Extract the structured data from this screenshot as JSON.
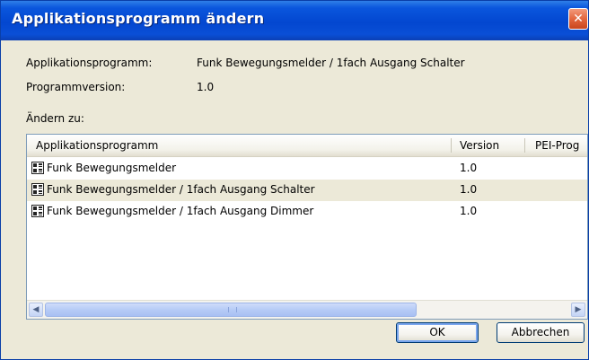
{
  "window": {
    "title": "Applikationsprogramm ändern",
    "close_glyph": "✕"
  },
  "current": {
    "program_label": "Applikationsprogramm:",
    "program_value": "Funk Bewegungsmelder / 1fach Ausgang Schalter",
    "version_label": "Programmversion:",
    "version_value": "1.0"
  },
  "change_to_label": "Ändern zu:",
  "table": {
    "columns": [
      "Applikationsprogramm",
      "Version",
      "PEI-Prog"
    ],
    "rows": [
      {
        "name": "Funk Bewegungsmelder",
        "version": "1.0",
        "icon": "application-program-icon",
        "selected": false
      },
      {
        "name": "Funk Bewegungsmelder / 1fach Ausgang Schalter",
        "version": "1.0",
        "icon": "application-program-icon",
        "selected": true
      },
      {
        "name": "Funk Bewegungsmelder / 1fach Ausgang Dimmer",
        "version": "1.0",
        "icon": "application-program-icon",
        "selected": false
      }
    ]
  },
  "scrollbar": {
    "left_glyph": "◀",
    "right_glyph": "▶"
  },
  "buttons": {
    "ok": "OK",
    "cancel": "Abbrechen"
  }
}
